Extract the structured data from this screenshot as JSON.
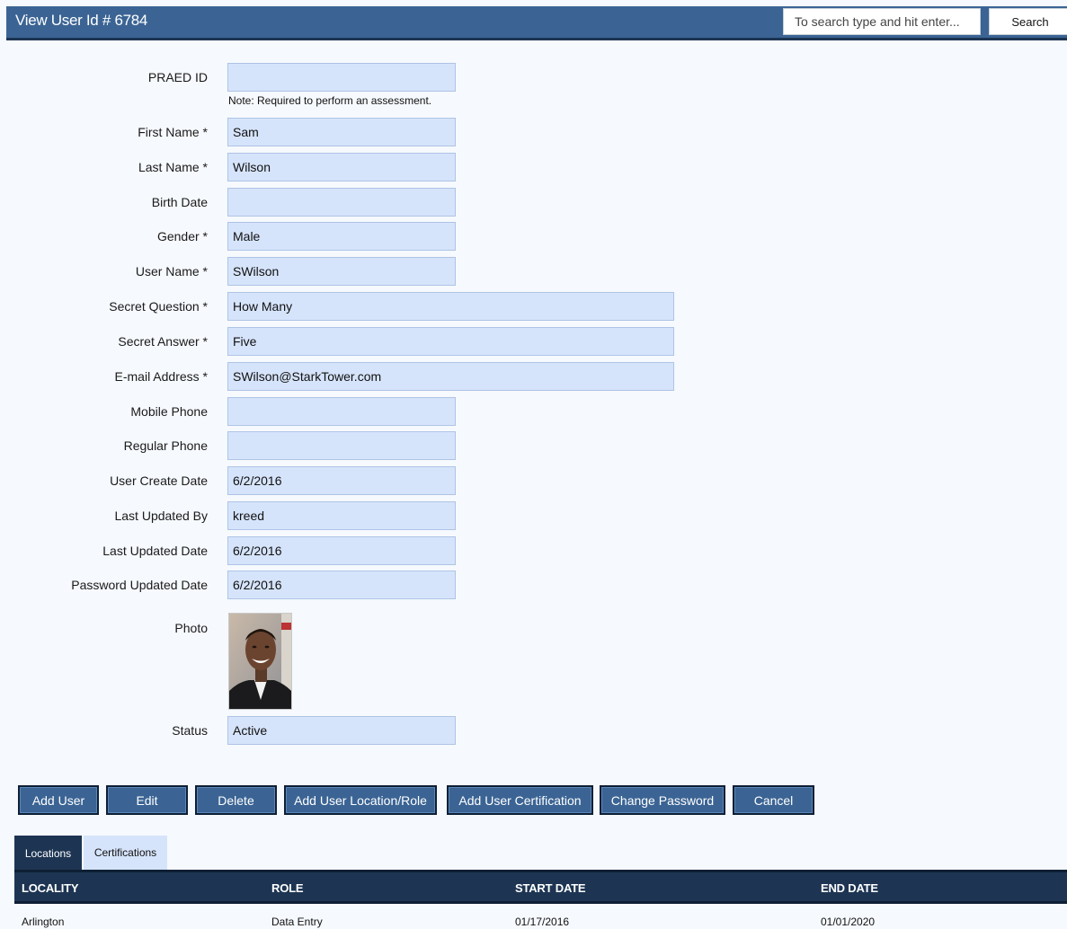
{
  "header": {
    "title": "View User Id # 6784",
    "search_placeholder": "To search type and hit enter...",
    "search_button": "Search"
  },
  "form": {
    "praed_id": {
      "label": "PRAED ID",
      "value": ""
    },
    "praed_note": "Note: Required to perform an assessment.",
    "first_name": {
      "label": "First Name *",
      "value": "Sam"
    },
    "last_name": {
      "label": "Last Name *",
      "value": "Wilson"
    },
    "birth_date": {
      "label": "Birth Date",
      "value": ""
    },
    "gender": {
      "label": "Gender *",
      "value": "Male"
    },
    "user_name": {
      "label": "User Name *",
      "value": "SWilson"
    },
    "secret_question": {
      "label": "Secret Question *",
      "value": "How Many"
    },
    "secret_answer": {
      "label": "Secret Answer *",
      "value": "Five"
    },
    "email": {
      "label": "E-mail Address *",
      "value": "SWilson@StarkTower.com"
    },
    "mobile_phone": {
      "label": "Mobile Phone",
      "value": ""
    },
    "regular_phone": {
      "label": "Regular Phone",
      "value": ""
    },
    "user_create_date": {
      "label": "User Create Date",
      "value": "6/2/2016"
    },
    "last_updated_by": {
      "label": "Last Updated By",
      "value": "kreed"
    },
    "last_updated_date": {
      "label": "Last Updated Date",
      "value": "6/2/2016"
    },
    "password_updated_date": {
      "label": "Password Updated Date",
      "value": "6/2/2016"
    },
    "photo_label": "Photo",
    "status": {
      "label": "Status",
      "value": "Active"
    }
  },
  "actions": {
    "add_user": "Add User",
    "edit": "Edit",
    "delete": "Delete",
    "add_location_role": "Add User Location/Role",
    "add_certification": "Add User Certification",
    "change_password": "Change Password",
    "cancel": "Cancel"
  },
  "tabs": {
    "locations": "Locations",
    "certifications": "Certifications"
  },
  "grid": {
    "headers": {
      "locality": "LOCALITY",
      "role": "ROLE",
      "start_date": "START DATE",
      "end_date": "END DATE"
    },
    "rows": [
      {
        "locality": "Arlington",
        "role": "Data Entry",
        "start_date": "01/17/2016",
        "end_date": "01/01/2020"
      }
    ]
  },
  "colors": {
    "header_blue": "#3b6494",
    "dark_navy": "#1d3553",
    "field_fill": "#d6e4fb"
  }
}
